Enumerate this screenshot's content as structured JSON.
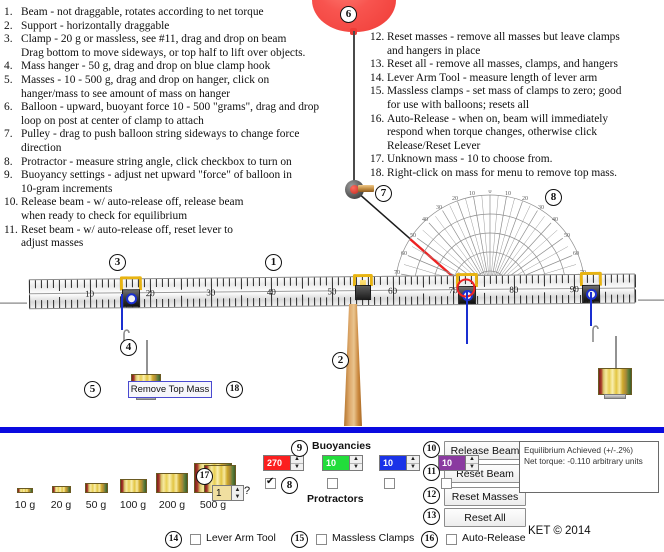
{
  "instructions_left": [
    {
      "num": "1.",
      "text": "Beam - not draggable, rotates according to net torque"
    },
    {
      "num": "2.",
      "text": "Support - horizontally draggable"
    },
    {
      "num": "3.",
      "text": "Clamp - 20 g or massless, see #11, drag and drop on beam\nDrag bottom to move sideways, or top half to lift over objects."
    },
    {
      "num": "4.",
      "text": "Mass hanger - 50 g, drag and drop on blue clamp hook"
    },
    {
      "num": "5.",
      "text": "Masses - 10 - 500 g, drag and drop on hanger, click on\nhanger/mass to see amount of mass on hanger"
    },
    {
      "num": "6.",
      "text": "Balloon - upward, buoyant force 10 - 500 \"grams\", drag and drop\nloop on post at center of clamp to attach"
    },
    {
      "num": "7.",
      "text": "Pulley - drag to push balloon string sideways to change force\ndirection"
    },
    {
      "num": "8.",
      "text": "Protractor - measure string angle, click checkbox to turn on"
    },
    {
      "num": "9.",
      "text": "Buoyancy settings - adjust net upward \"force\" of balloon in\n10-gram increments"
    },
    {
      "num": "10.",
      "text": "Release beam - w/ auto-release off, release beam\nwhen ready to check for equilibrium"
    },
    {
      "num": "11.",
      "text": "Reset beam - w/ auto-release off, reset lever to\nadjust masses"
    }
  ],
  "instructions_right": [
    {
      "num": "12.",
      "text": "Reset masses - remove all masses but leave clamps\nand hangers in place"
    },
    {
      "num": "13.",
      "text": "Reset all - remove all masses, clamps, and hangers"
    },
    {
      "num": "14.",
      "text": "Lever Arm Tool - measure length of lever arm"
    },
    {
      "num": "15.",
      "text": "Massless clamps - set mass of clamps to zero; good\nfor use with balloons; resets all"
    },
    {
      "num": "16.",
      "text": "Auto-Release - when on, beam will immediately\nrespond when torque changes, otherwise click\nRelease/Reset Lever"
    },
    {
      "num": "17.",
      "text": "Unknown mass - 10 to choose from."
    },
    {
      "num": "18.",
      "text": "Right-click on mass for menu to remove top mass."
    }
  ],
  "ruler": {
    "labels": [
      "10",
      "20",
      "30",
      "40",
      "50",
      "60",
      "70",
      "80",
      "90"
    ],
    "min": 0,
    "max": 100
  },
  "protractor": {
    "labels_left": [
      "0",
      "10",
      "20",
      "30",
      "40",
      "50",
      "60",
      "70",
      "80"
    ],
    "labels_right": [
      "10",
      "20",
      "30",
      "40",
      "50",
      "60",
      "70",
      "80"
    ]
  },
  "context_menu": {
    "remove_top_mass": "Remove Top Mass"
  },
  "mass_shelf": {
    "items": [
      {
        "label": "10 g",
        "grams": 10
      },
      {
        "label": "20 g",
        "grams": 20
      },
      {
        "label": "50 g",
        "grams": 50
      },
      {
        "label": "100 g",
        "grams": 100
      },
      {
        "label": "200 g",
        "grams": 200
      },
      {
        "label": "500 g",
        "grams": 500
      }
    ],
    "unknown_value": "1",
    "unknown_suffix": "?"
  },
  "buoyancies": {
    "title": "Buoyancies",
    "protractors_label": "Protractors",
    "spinners": [
      {
        "value": "270",
        "color": "#fb1f1f"
      },
      {
        "value": "10",
        "color": "#22dd3b"
      },
      {
        "value": "10",
        "color": "#1a33e8"
      },
      {
        "value": "10",
        "color": "#8a3aa0"
      }
    ],
    "protractor_checked": [
      true,
      false,
      false,
      false
    ]
  },
  "buttons": {
    "release_beam": "Release Beam",
    "reset_beam": "Reset Beam",
    "reset_masses": "Reset Masses",
    "reset_all": "Reset All"
  },
  "status": {
    "line1": "Equilibrium Achieved  (+/-.2%)",
    "line2": "Net torque: -0.110  arbitrary units"
  },
  "toggles": {
    "lever_arm_tool": "Lever Arm Tool",
    "lever_arm_checked": false,
    "massless_clamps": "Massless Clamps",
    "massless_checked": false,
    "auto_release": "Auto-Release",
    "auto_release_checked": false
  },
  "copyright": "KET © 2014",
  "markers": {
    "m1": "1",
    "m2": "2",
    "m3": "3",
    "m4": "4",
    "m5": "5",
    "m6": "6",
    "m7": "7",
    "m8": "8",
    "m9": "9",
    "m10": "10",
    "m11": "11",
    "m12": "12",
    "m13": "13",
    "m14": "14",
    "m15": "15",
    "m16": "16",
    "m17": "17",
    "m18": "18"
  },
  "colors": {
    "balloon": "#ef3b36",
    "divider": "#0b0be0",
    "clamp_yellow": "#e8b412",
    "hook_blue": "#1a2fd0",
    "string_red": "#ee2222"
  }
}
